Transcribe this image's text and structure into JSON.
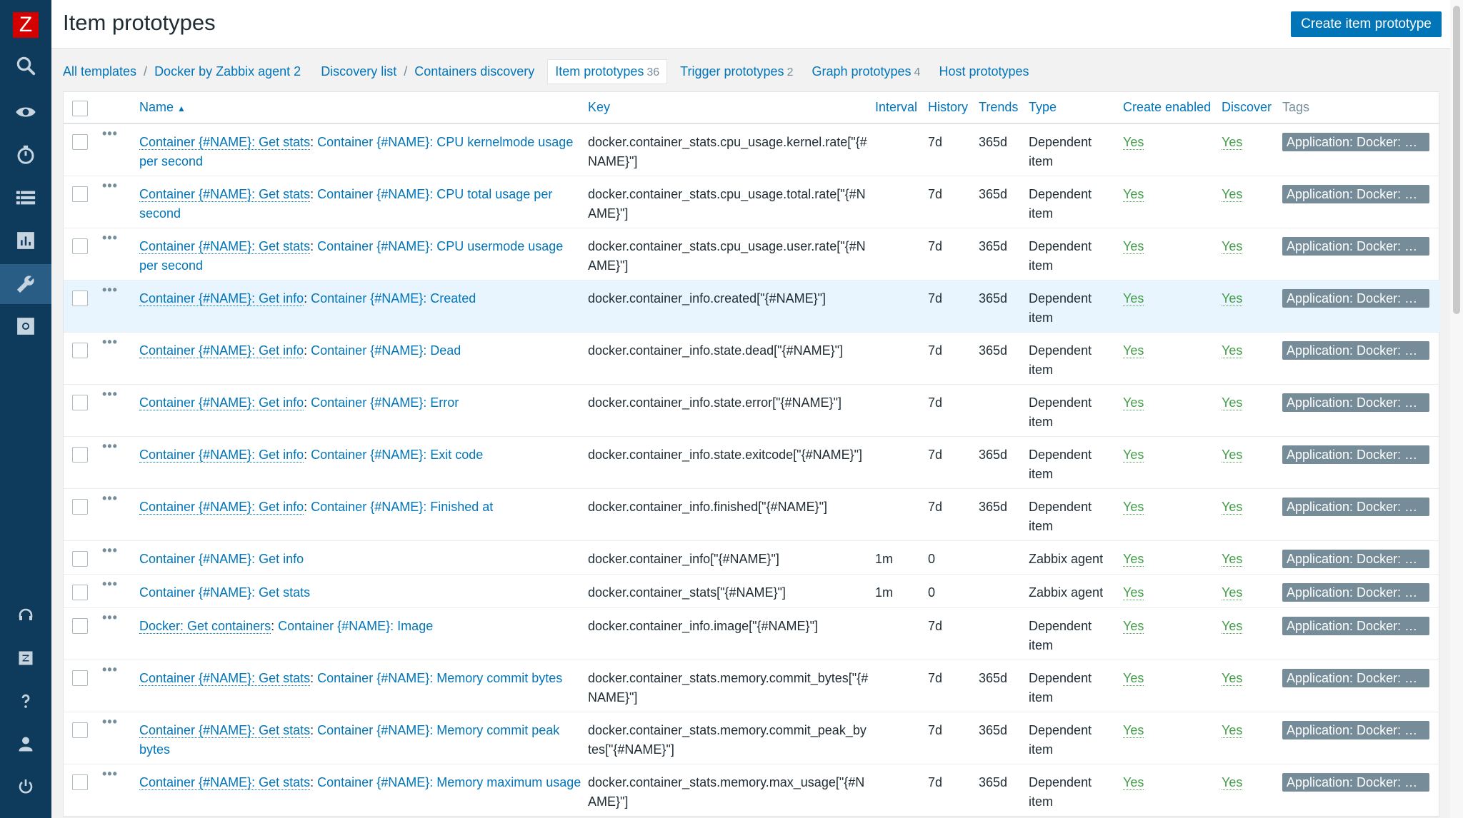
{
  "logo": "Z",
  "header": {
    "title": "Item prototypes",
    "create_label": "Create item prototype"
  },
  "sidebar": {
    "items": [
      "search-icon",
      "eye-icon",
      "stopwatch-icon",
      "list-icon",
      "chart-icon",
      "wrench-icon",
      "gear-icon"
    ],
    "bottom": [
      "headset-icon",
      "zabbix-icon",
      "help-icon",
      "user-icon",
      "power-icon"
    ]
  },
  "breadcrumb": {
    "all_templates": "All templates",
    "template": "Docker by Zabbix agent 2",
    "discovery_list": "Discovery list",
    "rule": "Containers discovery",
    "tabs": {
      "item_prototypes": "Item prototypes",
      "item_prototypes_count": "36",
      "trigger_prototypes": "Trigger prototypes",
      "trigger_prototypes_count": "2",
      "graph_prototypes": "Graph prototypes",
      "graph_prototypes_count": "4",
      "host_prototypes": "Host prototypes"
    }
  },
  "columns": {
    "name": "Name",
    "key": "Key",
    "interval": "Interval",
    "history": "History",
    "trends": "Trends",
    "type": "Type",
    "create_enabled": "Create enabled",
    "discover": "Discover",
    "tags": "Tags"
  },
  "rows": [
    {
      "master": "Container {#NAME}: Get stats",
      "name": "Container {#NAME}: CPU kernelmode usage per second",
      "key": "docker.container_stats.cpu_usage.kernel.rate[\"{#NAME}\"]",
      "interval": "",
      "history": "7d",
      "trends": "365d",
      "type": "Dependent item",
      "create_enabled": "Yes",
      "discover": "Yes",
      "tag": "Application: Docker: Container {#NAME}"
    },
    {
      "master": "Container {#NAME}: Get stats",
      "name": "Container {#NAME}: CPU total usage per second",
      "key": "docker.container_stats.cpu_usage.total.rate[\"{#NAME}\"]",
      "interval": "",
      "history": "7d",
      "trends": "365d",
      "type": "Dependent item",
      "create_enabled": "Yes",
      "discover": "Yes",
      "tag": "Application: Docker: Container {#NAME}"
    },
    {
      "master": "Container {#NAME}: Get stats",
      "name": "Container {#NAME}: CPU usermode usage per second",
      "key": "docker.container_stats.cpu_usage.user.rate[\"{#NAME}\"]",
      "interval": "",
      "history": "7d",
      "trends": "365d",
      "type": "Dependent item",
      "create_enabled": "Yes",
      "discover": "Yes",
      "tag": "Application: Docker: Container {#NAME}"
    },
    {
      "master": "Container {#NAME}: Get info",
      "name": "Container {#NAME}: Created",
      "key": "docker.container_info.created[\"{#NAME}\"]",
      "interval": "",
      "history": "7d",
      "trends": "365d",
      "type": "Dependent item",
      "create_enabled": "Yes",
      "discover": "Yes",
      "tag": "Application: Docker: Container {#NAME}"
    },
    {
      "master": "Container {#NAME}: Get info",
      "name": "Container {#NAME}: Dead",
      "key": "docker.container_info.state.dead[\"{#NAME}\"]",
      "interval": "",
      "history": "7d",
      "trends": "365d",
      "type": "Dependent item",
      "create_enabled": "Yes",
      "discover": "Yes",
      "tag": "Application: Docker: Container {#NAME}"
    },
    {
      "master": "Container {#NAME}: Get info",
      "name": "Container {#NAME}: Error",
      "key": "docker.container_info.state.error[\"{#NAME}\"]",
      "interval": "",
      "history": "7d",
      "trends": "",
      "type": "Dependent item",
      "create_enabled": "Yes",
      "discover": "Yes",
      "tag": "Application: Docker: Container {#NAME}"
    },
    {
      "master": "Container {#NAME}: Get info",
      "name": "Container {#NAME}: Exit code",
      "key": "docker.container_info.state.exitcode[\"{#NAME}\"]",
      "interval": "",
      "history": "7d",
      "trends": "365d",
      "type": "Dependent item",
      "create_enabled": "Yes",
      "discover": "Yes",
      "tag": "Application: Docker: Container {#NAME}"
    },
    {
      "master": "Container {#NAME}: Get info",
      "name": "Container {#NAME}: Finished at",
      "key": "docker.container_info.finished[\"{#NAME}\"]",
      "interval": "",
      "history": "7d",
      "trends": "365d",
      "type": "Dependent item",
      "create_enabled": "Yes",
      "discover": "Yes",
      "tag": "Application: Docker: Container {#NAME}"
    },
    {
      "master": "",
      "name": "Container {#NAME}: Get info",
      "key": "docker.container_info[\"{#NAME}\"]",
      "interval": "1m",
      "history": "0",
      "trends": "",
      "type": "Zabbix agent",
      "create_enabled": "Yes",
      "discover": "Yes",
      "tag": "Application: Docker: Container {#NAME}"
    },
    {
      "master": "",
      "name": "Container {#NAME}: Get stats",
      "key": "docker.container_stats[\"{#NAME}\"]",
      "interval": "1m",
      "history": "0",
      "trends": "",
      "type": "Zabbix agent",
      "create_enabled": "Yes",
      "discover": "Yes",
      "tag": "Application: Docker: Container {#NAME}"
    },
    {
      "master": "Docker: Get containers",
      "name": "Container {#NAME}: Image",
      "key": "docker.container_info.image[\"{#NAME}\"]",
      "interval": "",
      "history": "7d",
      "trends": "",
      "type": "Dependent item",
      "create_enabled": "Yes",
      "discover": "Yes",
      "tag": "Application: Docker: Container {#NAME}"
    },
    {
      "master": "Container {#NAME}: Get stats",
      "name": "Container {#NAME}: Memory commit bytes",
      "key": "docker.container_stats.memory.commit_bytes[\"{#NAME}\"]",
      "interval": "",
      "history": "7d",
      "trends": "365d",
      "type": "Dependent item",
      "create_enabled": "Yes",
      "discover": "Yes",
      "tag": "Application: Docker: Container {#NAME}"
    },
    {
      "master": "Container {#NAME}: Get stats",
      "name": "Container {#NAME}: Memory commit peak bytes",
      "key": "docker.container_stats.memory.commit_peak_bytes[\"{#NAME}\"]",
      "interval": "",
      "history": "7d",
      "trends": "365d",
      "type": "Dependent item",
      "create_enabled": "Yes",
      "discover": "Yes",
      "tag": "Application: Docker: Container {#NAME}"
    },
    {
      "master": "Container {#NAME}: Get stats",
      "name": "Container {#NAME}: Memory maximum usage",
      "key": "docker.container_stats.memory.max_usage[\"{#NAME}\"]",
      "interval": "",
      "history": "7d",
      "trends": "365d",
      "type": "Dependent item",
      "create_enabled": "Yes",
      "discover": "Yes",
      "tag": "Application: Docker: Container {#NAME}"
    }
  ]
}
